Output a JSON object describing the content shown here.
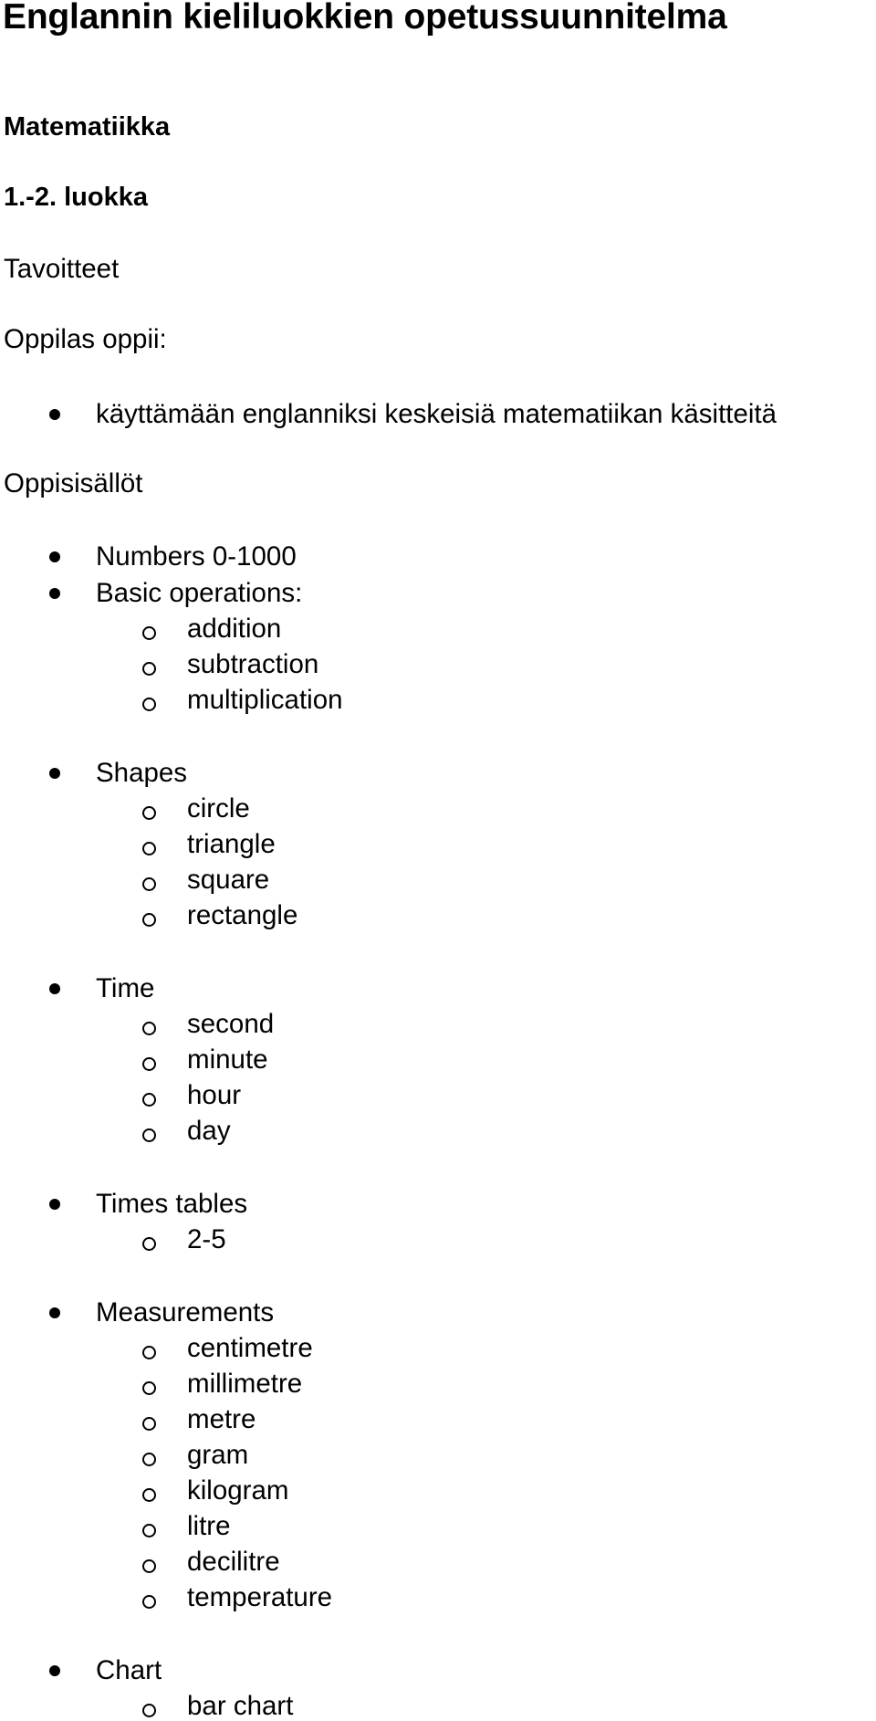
{
  "document": {
    "title": "Englannin kieliluokkien opetussuunnitelma",
    "subject": "Matematiikka",
    "grade": "1.-2. luokka",
    "goals_heading": "Tavoitteet",
    "goals_intro": "Oppilas oppii:",
    "goals": [
      "käyttämään englanniksi keskeisiä matematiikan käsitteitä"
    ],
    "content_heading": "Oppisisällöt",
    "content": [
      {
        "label": "Numbers 0-1000",
        "sub": []
      },
      {
        "label": "Basic operations:",
        "sub": [
          "addition",
          "subtraction",
          "multiplication"
        ]
      },
      {
        "label": "Shapes",
        "sub": [
          "circle",
          "triangle",
          "square",
          "rectangle"
        ]
      },
      {
        "label": "Time",
        "sub": [
          "second",
          "minute",
          "hour",
          "day"
        ]
      },
      {
        "label": "Times tables",
        "sub": [
          "2-5"
        ]
      },
      {
        "label": "Measurements",
        "sub": [
          "centimetre",
          "millimetre",
          "metre",
          "gram",
          "kilogram",
          "litre",
          "decilitre",
          "temperature"
        ]
      },
      {
        "label": "Chart",
        "sub": [
          "bar chart"
        ]
      }
    ]
  }
}
